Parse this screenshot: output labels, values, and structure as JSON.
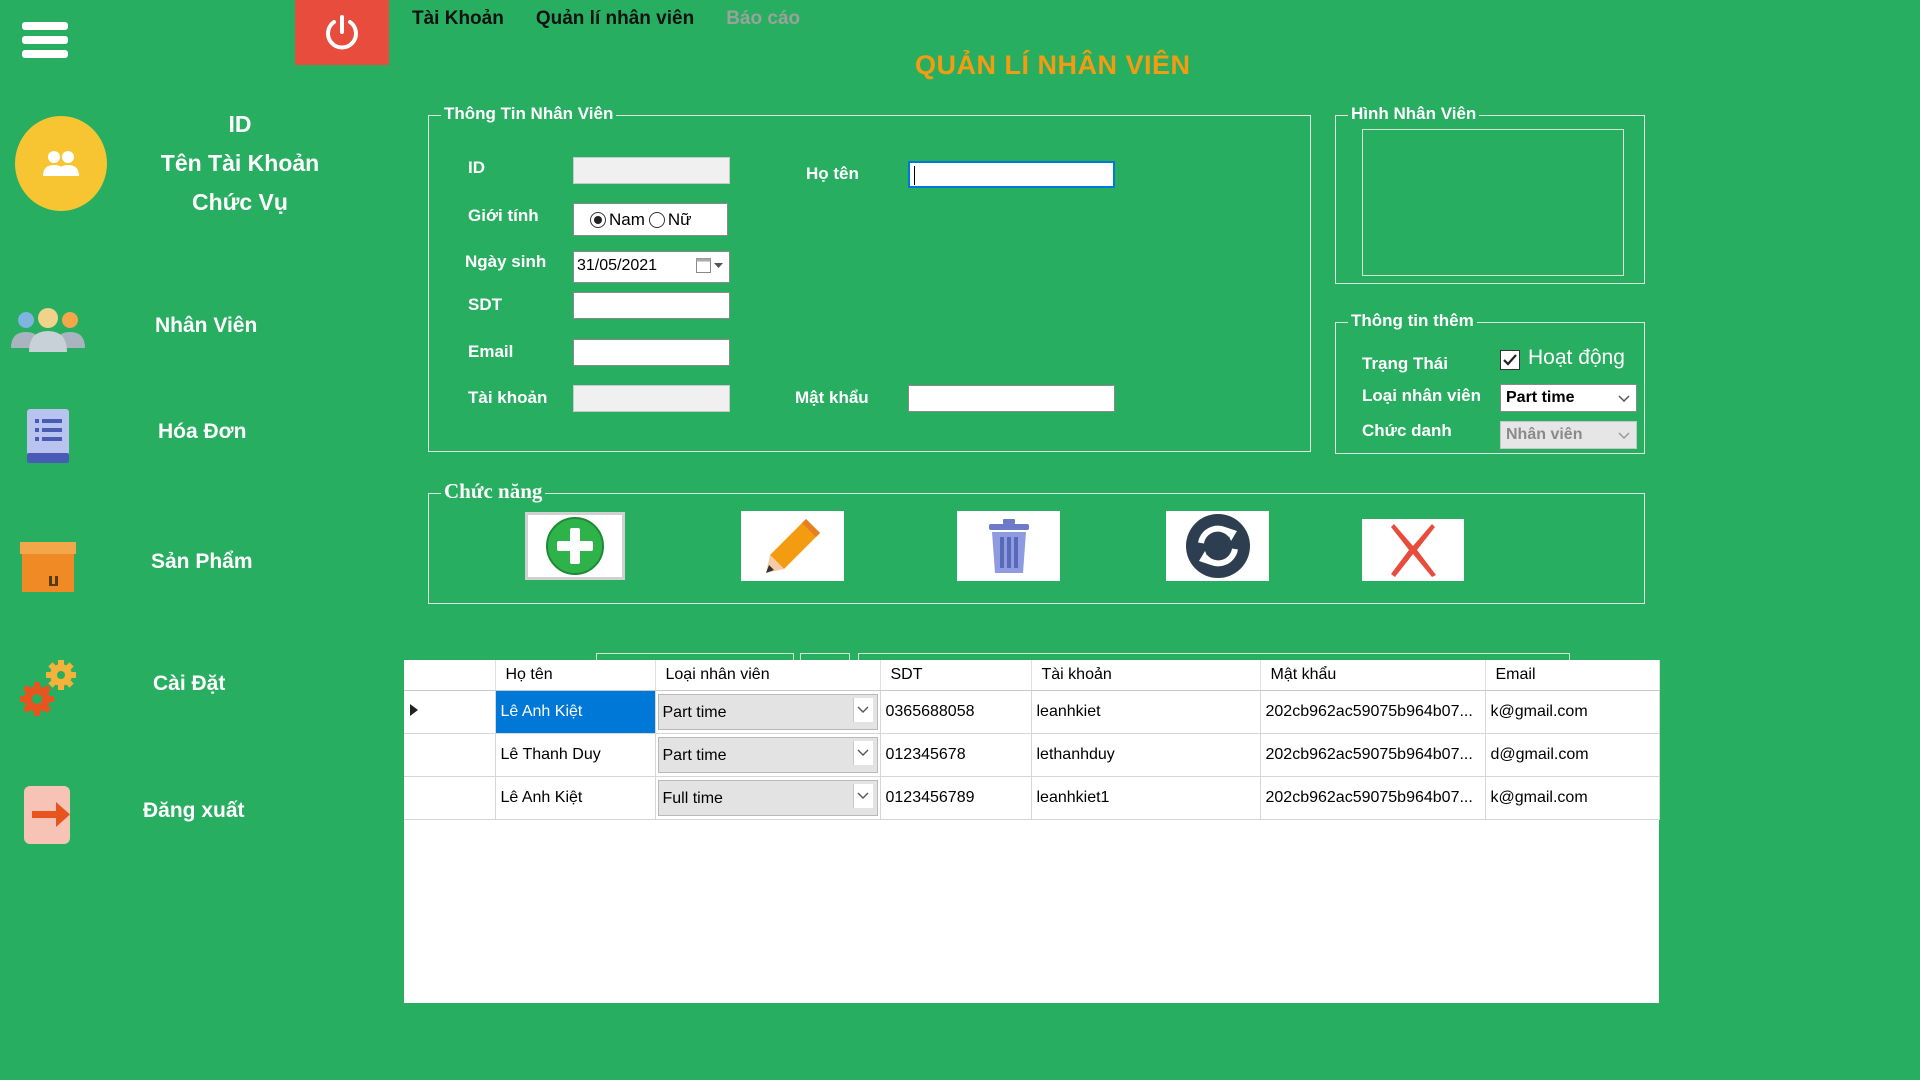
{
  "header": {
    "menu": [
      {
        "label": "Tài Khoản",
        "enabled": true
      },
      {
        "label": "Quản lí nhân viên",
        "enabled": true
      },
      {
        "label": "Báo cáo",
        "enabled": false
      }
    ],
    "title": "QUẢN LÍ NHÂN VIÊN",
    "menu_icon": "hamburger-icon",
    "power_icon": "power-icon"
  },
  "user": {
    "id_label": "ID",
    "account_label": "Tên Tài Khoản",
    "role_label": "Chức Vụ"
  },
  "sidebar": {
    "items": [
      {
        "label": "Nhân Viên",
        "icon": "employees-icon"
      },
      {
        "label": "Hóa Đơn",
        "icon": "invoice-icon"
      },
      {
        "label": "Sản Phẩm",
        "icon": "product-box-icon"
      },
      {
        "label": "Cài Đặt",
        "icon": "settings-gears-icon"
      },
      {
        "label": "Đăng xuất",
        "icon": "logout-icon"
      }
    ]
  },
  "employee_info": {
    "group_title": "Thông Tin Nhân Viên",
    "id_label": "ID",
    "id_value": "",
    "name_label": "Họ tên",
    "name_value": "",
    "gender_label": "Giới tính",
    "gender_male": "Nam",
    "gender_female": "Nữ",
    "gender_selected": "Nam",
    "dob_label": "Ngày sinh",
    "dob_value": "31/05/2021",
    "phone_label": "SDT",
    "phone_value": "",
    "email_label": "Email",
    "email_value": "",
    "account_label": "Tài khoản",
    "account_value": "",
    "password_label": "Mật khẩu",
    "password_value": ""
  },
  "photo": {
    "group_title": "Hình Nhân Viên"
  },
  "extra_info": {
    "group_title": "Thông tin thêm",
    "status_label": "Trạng Thái",
    "active_label": "Hoạt động",
    "active_checked": true,
    "type_label": "Loại nhân viên",
    "type_value": "Part time",
    "position_label": "Chức danh",
    "position_value": "Nhân viên"
  },
  "functions": {
    "group_title": "Chức năng",
    "buttons": [
      {
        "name": "add",
        "icon": "add-plus-icon"
      },
      {
        "name": "edit",
        "icon": "pencil-edit-icon"
      },
      {
        "name": "delete",
        "icon": "trash-icon"
      },
      {
        "name": "refresh",
        "icon": "refresh-icon"
      },
      {
        "name": "close",
        "icon": "close-x-icon"
      }
    ]
  },
  "grid": {
    "columns": [
      "Họ tên",
      "Loại nhân viên",
      "SDT",
      "Tài khoản",
      "Mật khẩu",
      "Email"
    ],
    "rows": [
      {
        "name": "Lê Anh Kiệt",
        "type": "Part time",
        "phone": "0365688058",
        "account": "leanhkiet",
        "password": "202cb962ac59075b964b07...",
        "email": "k@gmail.com"
      },
      {
        "name": "Lê Thanh Duy",
        "type": "Part time",
        "phone": "012345678",
        "account": "lethanhduy",
        "password": "202cb962ac59075b964b07...",
        "email": "d@gmail.com"
      },
      {
        "name": "Lê Anh Kiệt",
        "type": "Full time",
        "phone": "0123456789",
        "account": "leanhkiet1",
        "password": "202cb962ac59075b964b07...",
        "email": "k@gmail.com"
      }
    ],
    "selected_row": 0
  },
  "colors": {
    "background": "#27ae60",
    "title": "#f39c12",
    "power_button": "#e74c3c",
    "avatar": "#f7c531",
    "selection": "#0078d7"
  }
}
